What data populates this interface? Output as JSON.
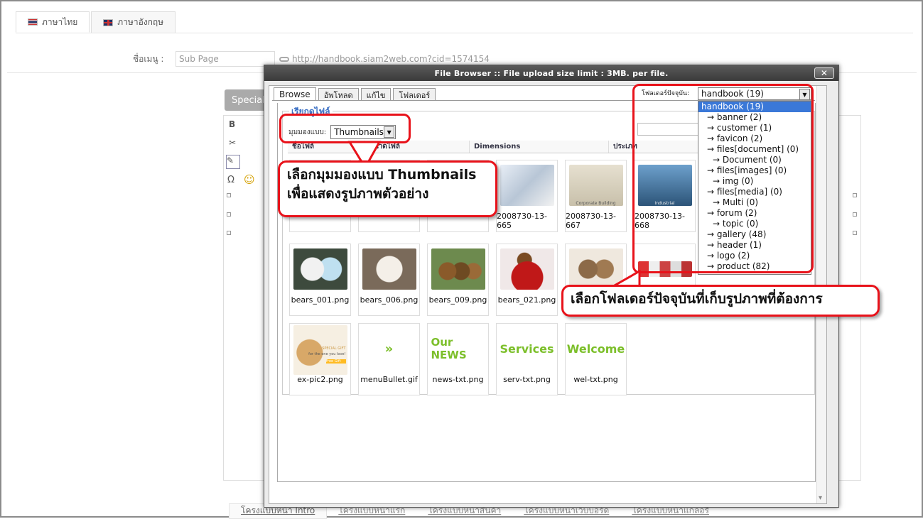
{
  "lang_tabs": [
    {
      "label": "ภาษาไทย"
    },
    {
      "label": "ภาษาอังกฤษ"
    }
  ],
  "menu_row": {
    "label": "ชื่อเมนู :",
    "input_value": "Sub Page",
    "url": "http://handbook.siam2web.com?cid=1574154"
  },
  "special_button": "Special",
  "bottom_tabs": [
    "โครงแบบหน้า Intro",
    "โครงแบบหน้าแรก",
    "โครงแบบหน้าสินค้า",
    "โครงแบบหน้าเว็บบอร์ด",
    "โครงแบบหน้าแกลอรี่"
  ],
  "modal": {
    "title": "File Browser :: File upload size limit : 3MB. per file.",
    "close_label": "✕",
    "tabs": [
      "Browse",
      "อัพโหลด",
      "แก้ไข",
      "โฟลเดอร์"
    ],
    "legend": "เรียกดูไฟล์",
    "view_label": "มุมมองแบบ:",
    "view_value": "Thumbnails",
    "columns": [
      "ชื่อไฟล์",
      "ขนาดไฟล์",
      "Dimensions",
      "ประเภท"
    ],
    "folder_label": "โฟลเดอร์ปัจจุบัน:",
    "folder_value": "handbook (19)",
    "folders": [
      "handbook (19)",
      "→ banner (2)",
      "→ customer (1)",
      "→ favicon (2)",
      "→ files[document] (0)",
      "→ Document (0)",
      "→ files[images] (0)",
      "→ img (0)",
      "→ files[media] (0)",
      "→ Multi (0)",
      "→ forum (2)",
      "→ topic (0)",
      "→ gallery (48)",
      "→ header (1)",
      "→ logo (2)",
      "→ product (82)"
    ],
    "thumbs_row1": [
      {
        "name": "2008730-13-665",
        "color": "#cfd8e4"
      },
      {
        "name": "2008730-13-667",
        "color": "#d7d2c4",
        "text": "Corporate Building"
      },
      {
        "name": "2008730-13-668",
        "color": "#4a7aa6",
        "text": "Industrial"
      }
    ],
    "thumbs_row2": [
      {
        "name": "bears_001.png",
        "color": "#3b4a3c"
      },
      {
        "name": "bears_006.png",
        "color": "#7a6a5a"
      },
      {
        "name": "bears_009.png",
        "color": "#556b3e"
      },
      {
        "name": "bears_021.png",
        "color": "#6a2323"
      },
      {
        "name": "",
        "color": "#d8cfc0"
      },
      {
        "name": "",
        "color": "#cc4433"
      }
    ],
    "thumbs_row3": [
      {
        "name": "ex-pic2.png",
        "color": "#e8d8bd"
      },
      {
        "name": "menuBullet.gif",
        "text": "»"
      },
      {
        "name": "news-txt.png",
        "text": "Our NEWS"
      },
      {
        "name": "serv-txt.png",
        "text": "Services"
      },
      {
        "name": "wel-txt.png",
        "text": "Welcome"
      }
    ],
    "ex_pic_text": {
      "top": "SPECIAL GIFT",
      "mid": "for the one you love!",
      "tag": "Free Gift"
    }
  },
  "callouts": {
    "thumbnails": "เลือกมุมมองแบบ Thumbnails\nเพื่อแสดงรูปภาพตัวอย่าง",
    "folder": "เลือกโฟลเดอร์ปัจจุบันที่เก็บรูปภาพที่ต้องการ"
  },
  "colors": {
    "accent_red": "#e8121a",
    "thumb_green": "#7cbf2a",
    "select_blue": "#3a78d8"
  }
}
